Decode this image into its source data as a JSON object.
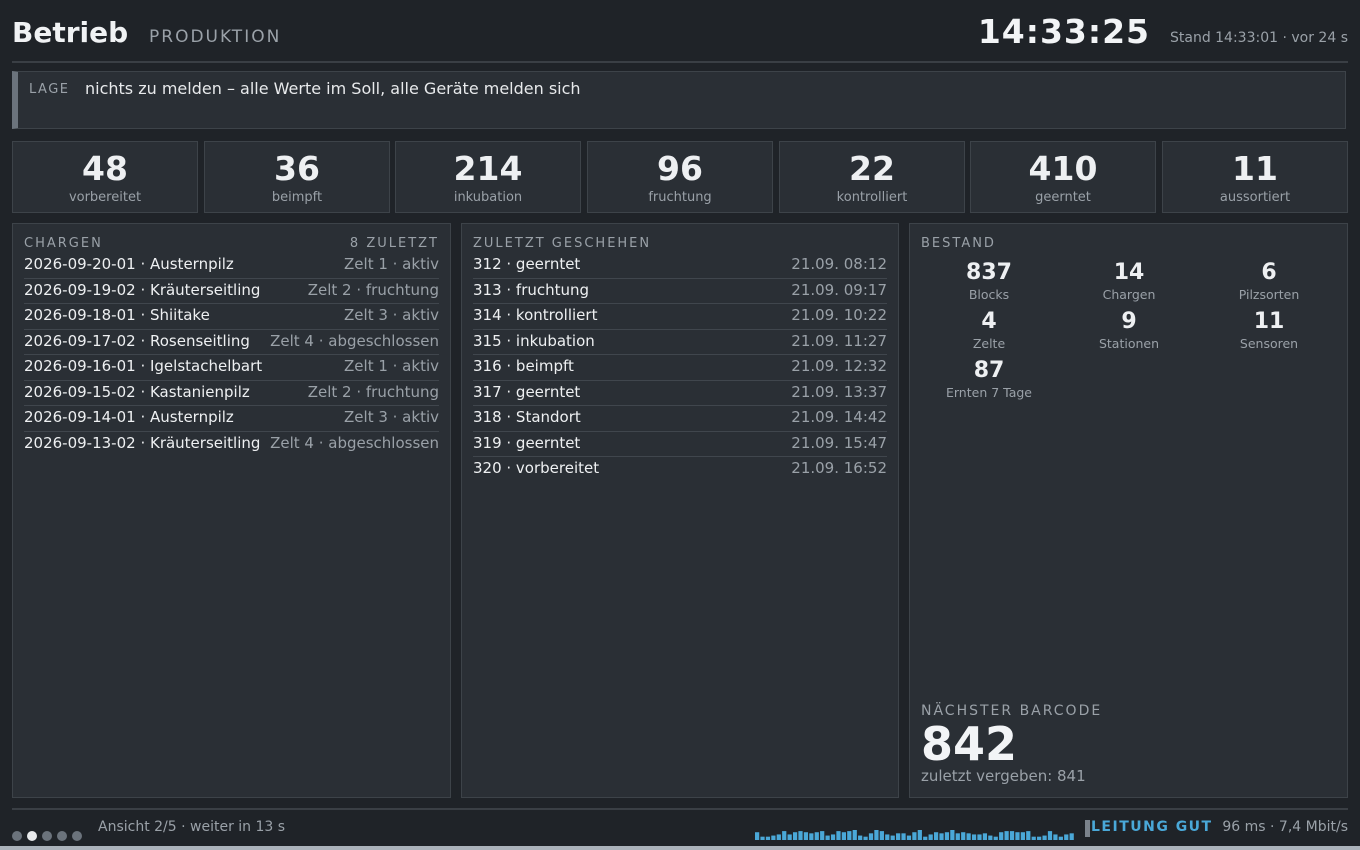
{
  "header": {
    "title": "Betrieb",
    "subtitle": "PRODUKTION",
    "clock": "14:33:25",
    "stand": "Stand 14:33:01 · vor 24 s"
  },
  "lage": {
    "label": "LAGE",
    "text": "nichts zu melden – alle Werte im Soll, alle Geräte melden sich"
  },
  "stats": [
    {
      "value": "48",
      "label": "vorbereitet"
    },
    {
      "value": "36",
      "label": "beimpft"
    },
    {
      "value": "214",
      "label": "inkubation"
    },
    {
      "value": "96",
      "label": "fruchtung"
    },
    {
      "value": "22",
      "label": "kontrolliert"
    },
    {
      "value": "410",
      "label": "geerntet"
    },
    {
      "value": "11",
      "label": "aussortiert"
    }
  ],
  "chargen": {
    "title": "CHARGEN",
    "count": "8 ZULETZT",
    "rows": [
      {
        "left": "2026-09-20-01 · Austernpilz",
        "right": "Zelt 1 · aktiv"
      },
      {
        "left": "2026-09-19-02 · Kräuterseitling",
        "right": "Zelt 2 · fruchtung"
      },
      {
        "left": "2026-09-18-01 · Shiitake",
        "right": "Zelt 3 · aktiv"
      },
      {
        "left": "2026-09-17-02 · Rosenseitling",
        "right": "Zelt 4 · abgeschlossen"
      },
      {
        "left": "2026-09-16-01 · Igelstachelbart",
        "right": "Zelt 1 · aktiv"
      },
      {
        "left": "2026-09-15-02 · Kastanienpilz",
        "right": "Zelt 2 · fruchtung"
      },
      {
        "left": "2026-09-14-01 · Austernpilz",
        "right": "Zelt 3 · aktiv"
      },
      {
        "left": "2026-09-13-02 · Kräuterseitling",
        "right": "Zelt 4 · abgeschlossen"
      }
    ]
  },
  "events": {
    "title": "ZULETZT GESCHEHEN",
    "rows": [
      {
        "left": "312 · geerntet",
        "right": "21.09. 08:12"
      },
      {
        "left": "313 · fruchtung",
        "right": "21.09. 09:17"
      },
      {
        "left": "314 · kontrolliert",
        "right": "21.09. 10:22"
      },
      {
        "left": "315 · inkubation",
        "right": "21.09. 11:27"
      },
      {
        "left": "316 · beimpft",
        "right": "21.09. 12:32"
      },
      {
        "left": "317 · geerntet",
        "right": "21.09. 13:37"
      },
      {
        "left": "318 · Standort",
        "right": "21.09. 14:42"
      },
      {
        "left": "319 · geerntet",
        "right": "21.09. 15:47"
      },
      {
        "left": "320 · vorbereitet",
        "right": "21.09. 16:52"
      }
    ]
  },
  "bestand": {
    "title": "BESTAND",
    "items": [
      {
        "value": "837",
        "label": "Blocks"
      },
      {
        "value": "14",
        "label": "Chargen"
      },
      {
        "value": "6",
        "label": "Pilzsorten"
      },
      {
        "value": "4",
        "label": "Zelte"
      },
      {
        "value": "9",
        "label": "Stationen"
      },
      {
        "value": "11",
        "label": "Sensoren"
      },
      {
        "value": "87",
        "label": "Ernten 7 Tage"
      }
    ],
    "barcode_label": "NÄCHSTER BARCODE",
    "barcode_value": "842",
    "barcode_last": "zuletzt vergeben: 841"
  },
  "footer": {
    "pages_total": 5,
    "page_active": 2,
    "ansicht": "Ansicht 2/5 · weiter in 13 s",
    "spark_color": "#4aa8d8",
    "spark": [
      7,
      3,
      3,
      4,
      5,
      8,
      5,
      7,
      8,
      7,
      6,
      7,
      8,
      4,
      5,
      8,
      7,
      8,
      9,
      4,
      3,
      6,
      9,
      8,
      5,
      4,
      6,
      6,
      4,
      7,
      9,
      3,
      5,
      7,
      6,
      7,
      9,
      6,
      7,
      6,
      5,
      5,
      6,
      4,
      3,
      7,
      8,
      8,
      7,
      7,
      8,
      3,
      3,
      4,
      8,
      5,
      3,
      5,
      6
    ],
    "status": "LEITUNG GUT",
    "metric": "96 ms · 7,4 Mbit/s"
  },
  "colors": {
    "background": "#1f2328",
    "panel": "#2a2f35",
    "accent": "#4aa8d8",
    "muted": "#9aa1a8"
  }
}
